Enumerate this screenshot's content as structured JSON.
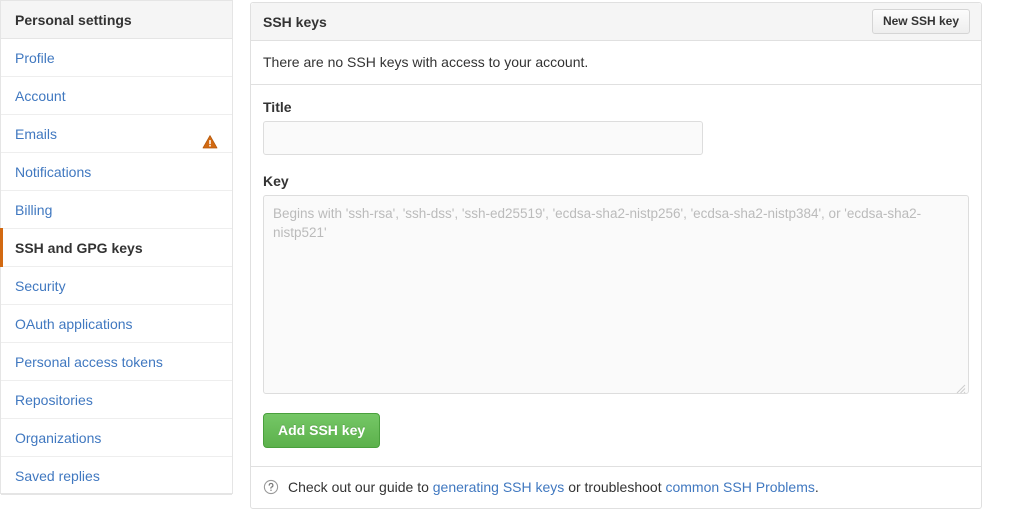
{
  "sidebar": {
    "header": "Personal settings",
    "items": [
      {
        "label": "Profile",
        "selected": false,
        "badge": null
      },
      {
        "label": "Account",
        "selected": false,
        "badge": null
      },
      {
        "label": "Emails",
        "selected": false,
        "badge": "alert-triangle-icon"
      },
      {
        "label": "Notifications",
        "selected": false,
        "badge": null
      },
      {
        "label": "Billing",
        "selected": false,
        "badge": null
      },
      {
        "label": "SSH and GPG keys",
        "selected": true,
        "badge": null
      },
      {
        "label": "Security",
        "selected": false,
        "badge": null
      },
      {
        "label": "OAuth applications",
        "selected": false,
        "badge": null
      },
      {
        "label": "Personal access tokens",
        "selected": false,
        "badge": null
      },
      {
        "label": "Repositories",
        "selected": false,
        "badge": null
      },
      {
        "label": "Organizations",
        "selected": false,
        "badge": null
      },
      {
        "label": "Saved replies",
        "selected": false,
        "badge": null
      }
    ]
  },
  "panel": {
    "title": "SSH keys",
    "new_key_button": "New SSH key",
    "empty_state": "There are no SSH keys with access to your account.",
    "form": {
      "title_label": "Title",
      "title_value": "",
      "title_placeholder": "",
      "key_label": "Key",
      "key_value": "",
      "key_placeholder": "Begins with 'ssh-rsa', 'ssh-dss', 'ssh-ed25519', 'ecdsa-sha2-nistp256', 'ecdsa-sha2-nistp384', or 'ecdsa-sha2-nistp521'",
      "submit_label": "Add SSH key"
    },
    "footer": {
      "icon": "question-circle-icon",
      "text_before": "Check out our guide to",
      "link_one": "generating SSH keys",
      "text_middle": "or troubleshoot",
      "link_two": "common SSH Problems",
      "text_after": "."
    }
  },
  "colors": {
    "link": "#4078c0",
    "selected_bar": "#d26911",
    "alert": "#d26911",
    "submit_button": "#5cb14c",
    "header_bg": "#f5f5f5",
    "border": "#e0e0e0"
  }
}
